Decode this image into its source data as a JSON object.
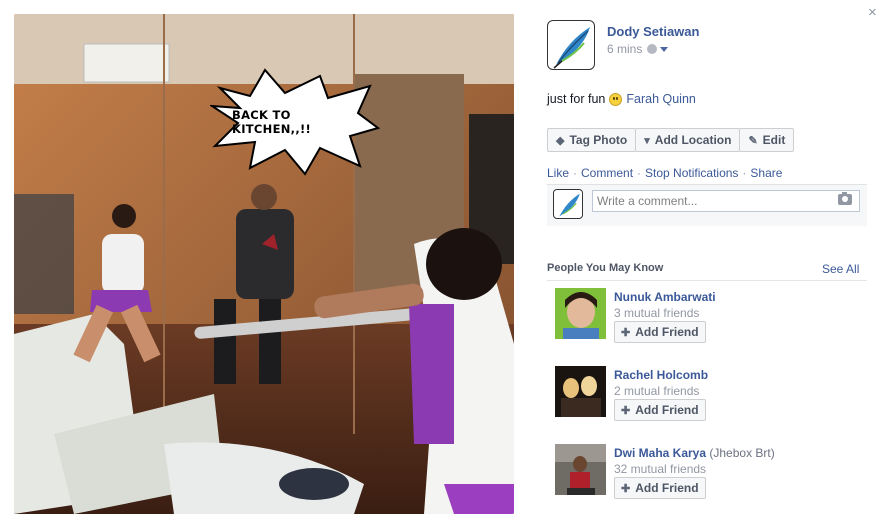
{
  "photo": {
    "speech_text": "BACK TO KITCHEN,,!!"
  },
  "close_label": "×",
  "post": {
    "author": "Dody Setiawan",
    "time": "6 mins",
    "audience_icon": "globe-icon",
    "status_text": "just for fun",
    "tagged": "Farah Quinn"
  },
  "actions": {
    "tag_photo": "Tag Photo",
    "add_location": "Add Location",
    "edit": "Edit"
  },
  "ufi": {
    "like": "Like",
    "comment": "Comment",
    "stop_notifications": "Stop Notifications",
    "share": "Share",
    "separator": "·",
    "comment_placeholder": "Write a comment..."
  },
  "pymk": {
    "title": "People You May Know",
    "see_all": "See All",
    "add_friend": "Add Friend",
    "people": [
      {
        "name": "Nunuk Ambarwati",
        "alias": "",
        "mutual": "3 mutual friends"
      },
      {
        "name": "Rachel Holcomb",
        "alias": "",
        "mutual": "2 mutual friends"
      },
      {
        "name": "Dwi Maha Karya",
        "alias": "(Jhebox Brt)",
        "mutual": "32 mutual friends"
      }
    ]
  },
  "colors": {
    "link": "#3b5998",
    "muted": "#9197a3",
    "button_bg": "#f6f7f8"
  }
}
